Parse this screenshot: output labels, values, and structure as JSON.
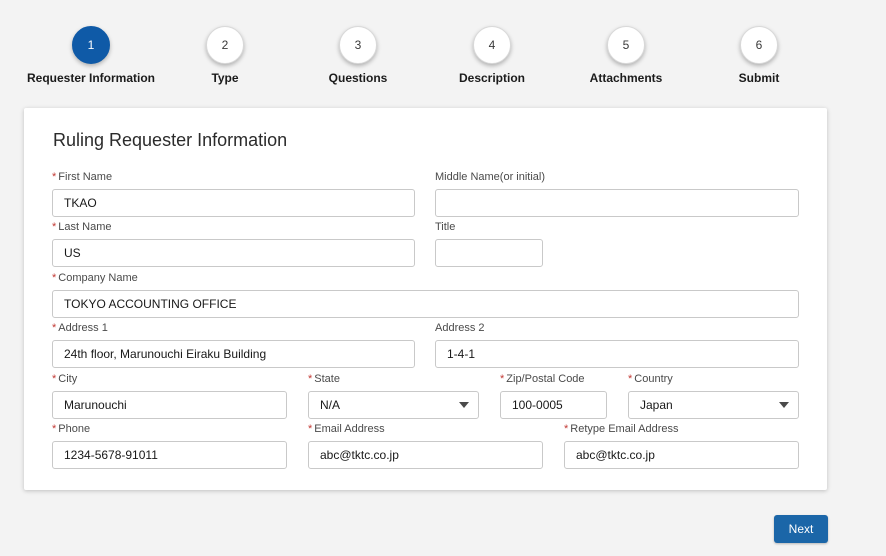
{
  "steps": [
    {
      "number": "1",
      "label": "Requester Information",
      "active": true
    },
    {
      "number": "2",
      "label": "Type",
      "active": false
    },
    {
      "number": "3",
      "label": "Questions",
      "active": false
    },
    {
      "number": "4",
      "label": "Description",
      "active": false
    },
    {
      "number": "5",
      "label": "Attachments",
      "active": false
    },
    {
      "number": "6",
      "label": "Submit",
      "active": false
    }
  ],
  "form": {
    "title": "Ruling Requester Information",
    "required_marker": "*",
    "first_name": {
      "label": "First Name",
      "value": "TKAO",
      "required": true
    },
    "middle_name": {
      "label": "Middle Name(or initial)",
      "value": "",
      "required": false
    },
    "last_name": {
      "label": "Last Name",
      "value": "US",
      "required": true
    },
    "title_field": {
      "label": "Title",
      "value": "",
      "required": false
    },
    "company_name": {
      "label": "Company Name",
      "value": "TOKYO ACCOUNTING OFFICE",
      "required": true
    },
    "address1": {
      "label": "Address 1",
      "value": "24th floor, Marunouchi Eiraku Building",
      "required": true
    },
    "address2": {
      "label": "Address 2",
      "value": "1-4-1",
      "required": false
    },
    "city": {
      "label": "City",
      "value": "Marunouchi",
      "required": true
    },
    "state": {
      "label": "State",
      "value": "N/A",
      "required": true
    },
    "zip": {
      "label": "Zip/Postal Code",
      "value": "100-0005",
      "required": true
    },
    "country": {
      "label": "Country",
      "value": "Japan",
      "required": true
    },
    "phone": {
      "label": "Phone",
      "value": "1234-5678-91011",
      "required": true
    },
    "email": {
      "label": "Email Address",
      "value": "abc@tktc.co.jp",
      "required": true
    },
    "retype_email": {
      "label": "Retype Email Address",
      "value": "abc@tktc.co.jp",
      "required": true
    }
  },
  "actions": {
    "next_label": "Next"
  },
  "colors": {
    "active_step": "#0f5aa7",
    "primary_button": "#1b66a8",
    "required_marker": "#c23934"
  },
  "icons": {
    "select_caret": "chevron-down-icon"
  }
}
